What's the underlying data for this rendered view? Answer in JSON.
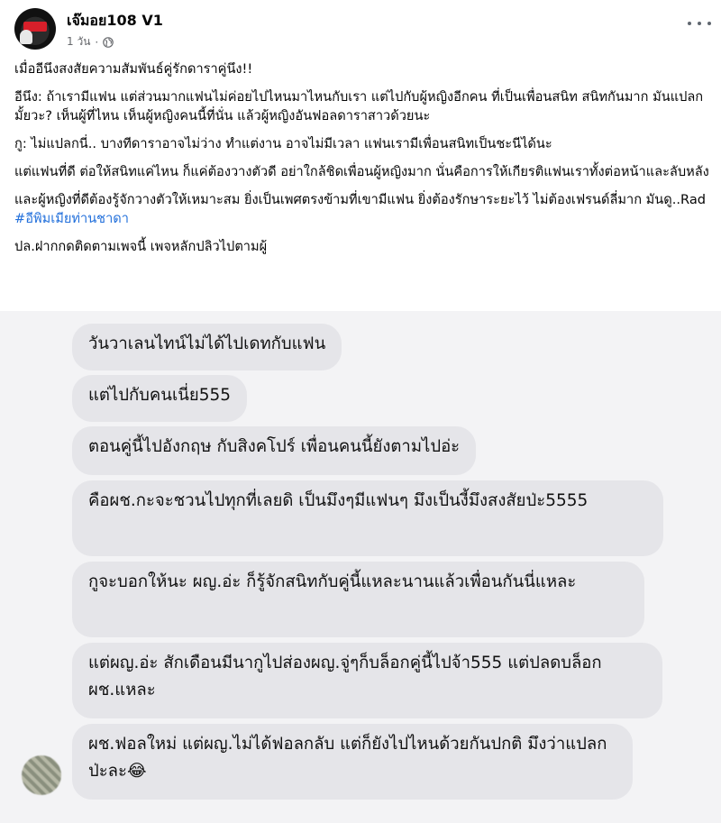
{
  "post": {
    "author": "เจ๊มอย108 V1",
    "time": "1 วัน",
    "dot": "·",
    "paragraphs": [
      {
        "text": "เมื่ออีนึงสงสัยความสัมพันธ์คู่รักดาราคู่นึง!!"
      },
      {
        "text": "อีนึง: ถ้าเรามีแฟน แต่ส่วนมากแฟนไม่ค่อยไปไหนมาไหนกับเรา แต่ไปกับผู้หญิงอีกคน ที่เป็นเพื่อนสนิท สนิทกันมาก มันแปลกมั้ยวะ? เห็นผู้ที่ไหน เห็นผู้หญิงคนนี้ที่นั่น แล้วผู้หญิงอันฟอลดาราสาวด้วยนะ"
      },
      {
        "text": "กู: ไม่แปลกนี่.. บางทีดาราอาจไม่ว่าง ทำแต่งาน อาจไม่มีเวลา แฟนเรามีเพื่อนสนิทเป็นชะนีได้นะ"
      },
      {
        "text": "แต่แฟนที่ดี ต่อให้สนิทแค่ไหน ก็แค่ต้องวางตัวดี อย่าใกล้ชิดเพื่อนผู้หญิงมาก นั่นคือการให้เกียรติแฟนเราทั้งต่อหน้าและลับหลัง"
      },
      {
        "text": "และผู้หญิงที่ดีต้องรู้จักวางตัวให้เหมาะสม ยิ่งเป็นเพศตรงข้ามที่เขามีแฟน ยิ่งต้องรักษาระยะไว้ ไม่ต้องเฟรนด์ลี่มาก มันดู..Rad ",
        "hashtag": "#อีพิมเมียท่านชาดา"
      },
      {
        "text": "ปล.ฝากกดติดตามเพจนี้ เพจหลักปลิวไปตามผู้"
      }
    ]
  },
  "chat": {
    "messages": [
      "วันวาเลนไทน์ไม่ได้ไปเดทกับแฟน",
      "แต่ไปกับคนเนี่ย555",
      "ตอนคู่นี้ไปอังกฤษ กับสิงคโปร์ เพื่อนคนนี้ยังตามไปอ่ะ",
      "คือผช.กะจะชวนไปทุกที่เลยดิ เป็นมึงๆมีแฟนๆ มึงเป็นงี้มึงสงสัยป่ะ5555",
      "กูจะบอกให้นะ ผญ.อ่ะ ก็รู้จักสนิทกับคู่นี้แหละนานแล้วเพื่อนกันนี่แหละ",
      "แต่ผญ.อ่ะ สักเดือนมีนากูไปส่องผญ.จู่ๆก็บล็อกคู่นี้ไปจ้า555 แต่ปลดบล็อกผช.แหละ",
      "ผช.ฟอลใหม่ แต่ผญ.ไม่ได้ฟอลกลับ แต่ก็ยังไปไหนด้วยกันปกติ มึงว่าแปลกป่ะละ😂"
    ]
  },
  "icons": {
    "globe": "globe-icon",
    "more": "more-options-icon",
    "avatar": "page-avatar"
  },
  "colors": {
    "hashtag": "#216fdb",
    "bubble": "#e5e5e9",
    "chat_bg": "#f3f3f5",
    "meta": "#65676b"
  }
}
